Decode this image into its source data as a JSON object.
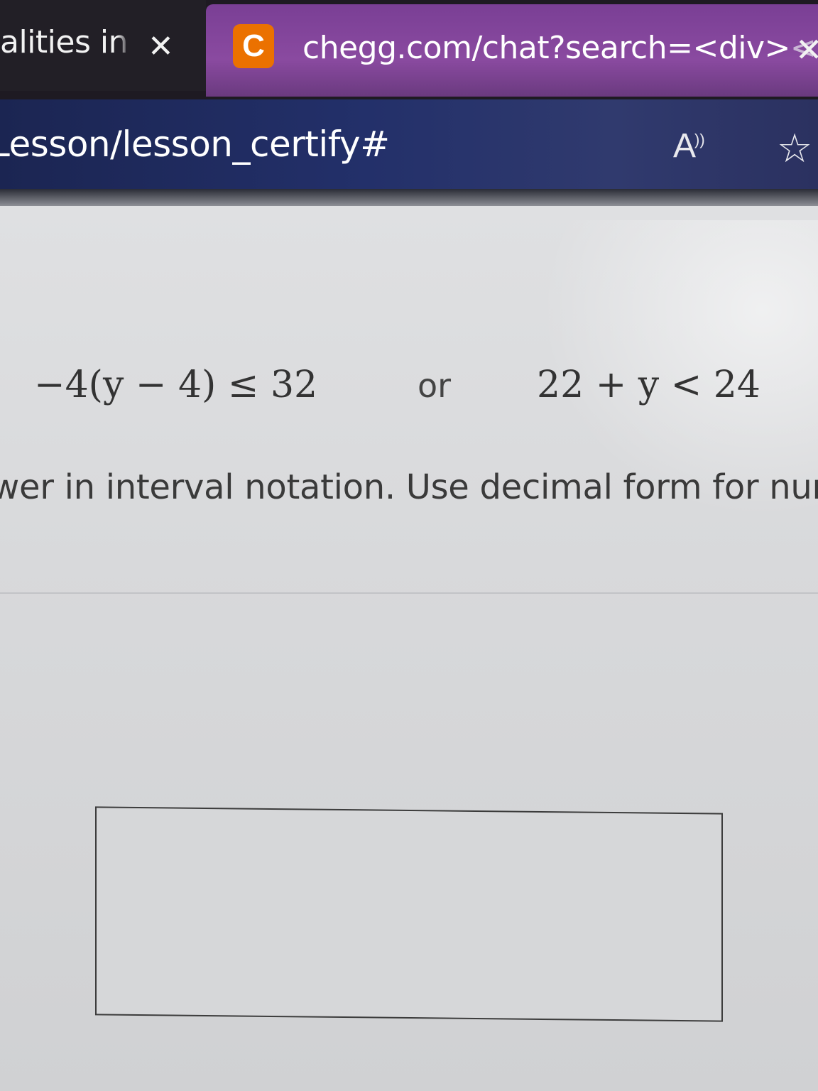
{
  "tabs": [
    {
      "title": "alities in",
      "close": "✕"
    },
    {
      "favicon": "C",
      "title": "chegg.com/chat?search=<div>",
      "title_tail": "<",
      "close": "✕"
    }
  ],
  "address_bar": {
    "url": "Lesson/lesson_certify#",
    "read_aloud_icon": "A",
    "read_aloud_mark": "))",
    "favorite_icon": "☆"
  },
  "problem": {
    "inequality_1": "−4(y − 4) ≤ 32",
    "connector": "or",
    "inequality_2": "22 + y < 24",
    "instruction": "wer in interval notation. Use decimal form for nun"
  },
  "answer": {
    "value": ""
  }
}
